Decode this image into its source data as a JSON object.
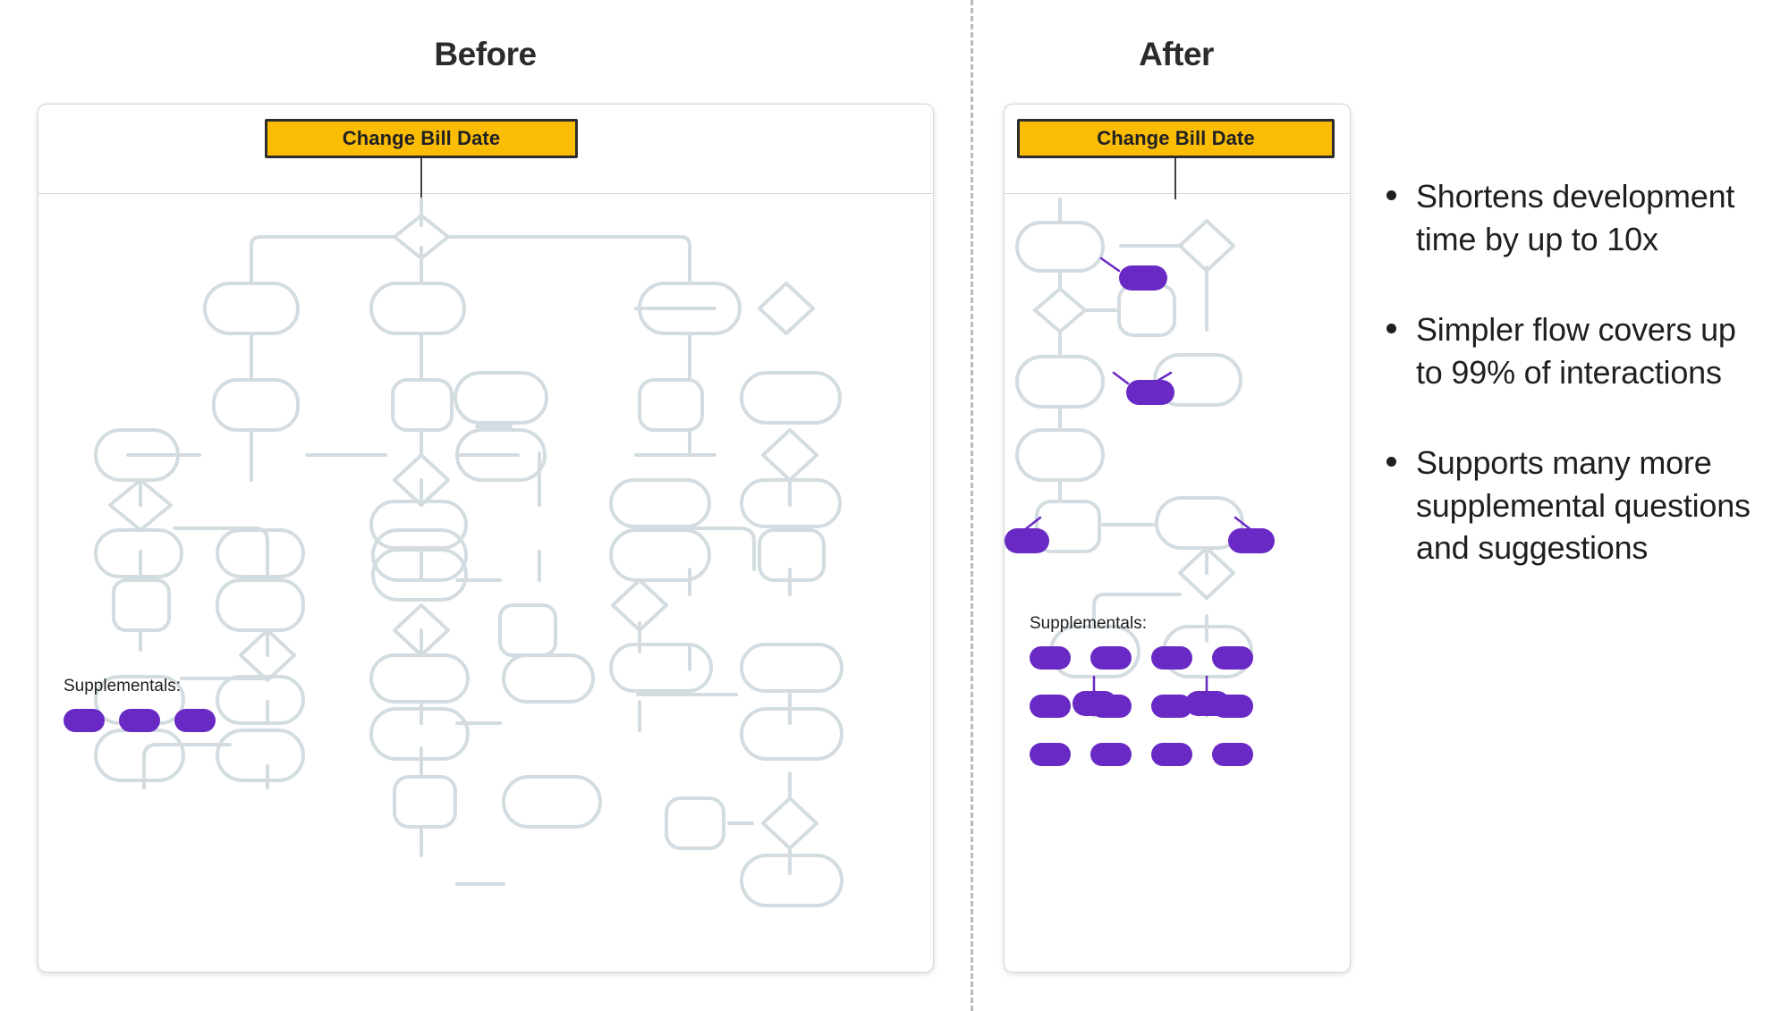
{
  "columns": {
    "before": {
      "title": "Before"
    },
    "after": {
      "title": "After"
    }
  },
  "entry_node": {
    "label": "Change Bill Date",
    "fill": "#fbbc04",
    "border": "#2d2d2d"
  },
  "before_panel": {
    "supplementals_label": "Supplementals:",
    "supplemental_pill_rows": [
      [
        "pill",
        "pill",
        "pill"
      ]
    ],
    "supplemental_count": 3
  },
  "after_panel": {
    "supplementals_label": "Supplementals:",
    "supplemental_pill_rows": [
      [
        "pill",
        "pill",
        "pill",
        "pill"
      ],
      [
        "pill",
        "pill",
        "pill",
        "pill"
      ],
      [
        "pill",
        "pill",
        "pill",
        "pill"
      ]
    ],
    "supplemental_count": 12
  },
  "bullets": [
    {
      "text": "Shortens development time by up to 10x"
    },
    {
      "text": "Simpler flow covers up to 99% of interactions"
    },
    {
      "text": "Supports many more supplemental questions and suggestions"
    }
  ],
  "colors": {
    "accent_purple": "#6929c4",
    "accent_yellow": "#fbbc04",
    "node_stroke": "#d3dce0",
    "node_fill": "#ffffff",
    "divider": "#b9b9b9",
    "text": "#1f1f1f"
  },
  "chart_data": {
    "type": "diagram",
    "title": "Before / After conversational flow comparison",
    "diagrams": [
      {
        "name": "before",
        "entry": "Change Bill Date",
        "node_count": 58,
        "decision_count": 12,
        "supplemental_count": 3,
        "description": "Dense multi-column decision tree with many process nodes and branch diamonds"
      },
      {
        "name": "after",
        "entry": "Change Bill Date",
        "node_count": 13,
        "decision_count": 4,
        "supplemental_count": 12,
        "inline_supplemental_count": 6,
        "description": "Condensed single-spine flow with inline purple supplemental chips"
      }
    ],
    "annotations": [
      "Shortens development time by up to 10x",
      "Simpler flow covers up to 99% of interactions",
      "Supports many more supplemental questions and suggestions"
    ]
  }
}
